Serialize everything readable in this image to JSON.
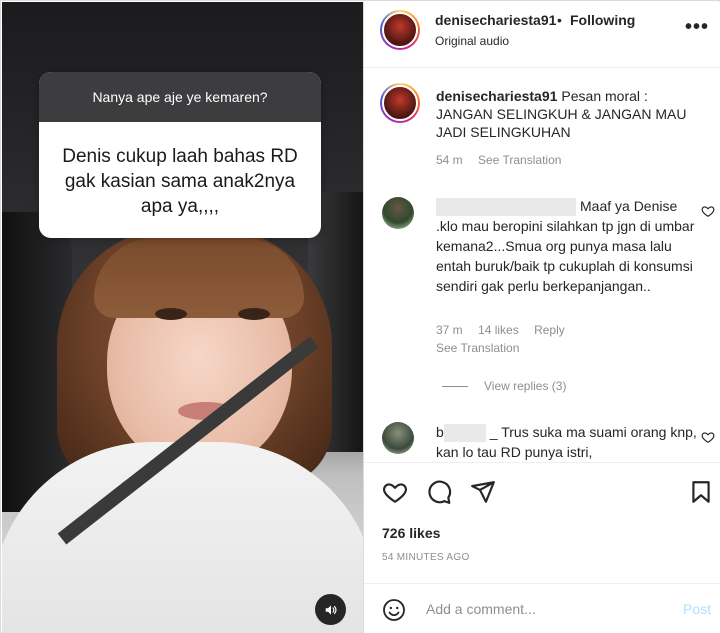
{
  "media": {
    "question_header": "Nanya ape aje ye kemaren?",
    "question_body": "Denis cukup laah bahas RD gak kasian sama anak2nya apa ya,,,,",
    "sound_icon": "speaker-icon"
  },
  "post_header": {
    "username": "denisechariesta91",
    "separator": "•",
    "follow_state": "Following",
    "audio": "Original audio",
    "more_icon": "•••"
  },
  "caption": {
    "username": "denisechariesta91",
    "text": "Pesan moral : JANGAN SELINGKUH & JANGAN MAU JADI SELINGKUHAN",
    "time": "54 m",
    "translation": "See Translation"
  },
  "comments": [
    {
      "text": "Maaf ya Denise .klo mau beropini silahkan tp jgn di umbar kemana2...Smua org punya masa lalu entah buruk/baik tp cukuplah di konsumsi sendiri gak perlu berkepanjangan..",
      "time": "37 m",
      "likes": "14 likes",
      "reply": "Reply",
      "translation": "See Translation",
      "view_replies": "View replies (3)"
    },
    {
      "prefix": "b",
      "suffix": "_",
      "text": "Trus suka ma suami orang knp, kan lo tau RD punya istri,"
    }
  ],
  "actions": {
    "likes": "726 likes",
    "time_ago": "54 MINUTES AGO"
  },
  "add_comment": {
    "placeholder": "Add a comment...",
    "post": "Post"
  },
  "colors": {
    "link_blue_disabled": "#b2dffc",
    "meta_gray": "#8e8e8e",
    "text": "#262626"
  }
}
